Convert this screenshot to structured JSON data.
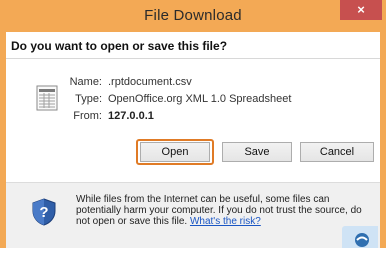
{
  "window": {
    "title": "File Download",
    "close_label": "×",
    "question": "Do you want to open or save this file?"
  },
  "file": {
    "name_label": "Name:",
    "name": ".rptdocument.csv",
    "type_label": "Type:",
    "type": "OpenOffice.org XML 1.0 Spreadsheet",
    "from_label": "From:",
    "from": "127.0.0.1"
  },
  "buttons": {
    "open": "Open",
    "save": "Save",
    "cancel": "Cancel"
  },
  "warning": {
    "text": "While files from the Internet can be useful, some files can potentially harm your computer. If you do not trust the source, do not open or save this file.",
    "link": "What's the risk?"
  },
  "icons": {
    "file": "spreadsheet-file-icon",
    "warning": "security-shield-icon",
    "tray": "app-tray-icon"
  },
  "colors": {
    "title_bar": "#f3a955",
    "close_button": "#c7504f",
    "highlight": "#e07b26",
    "link": "#1a56c4"
  }
}
